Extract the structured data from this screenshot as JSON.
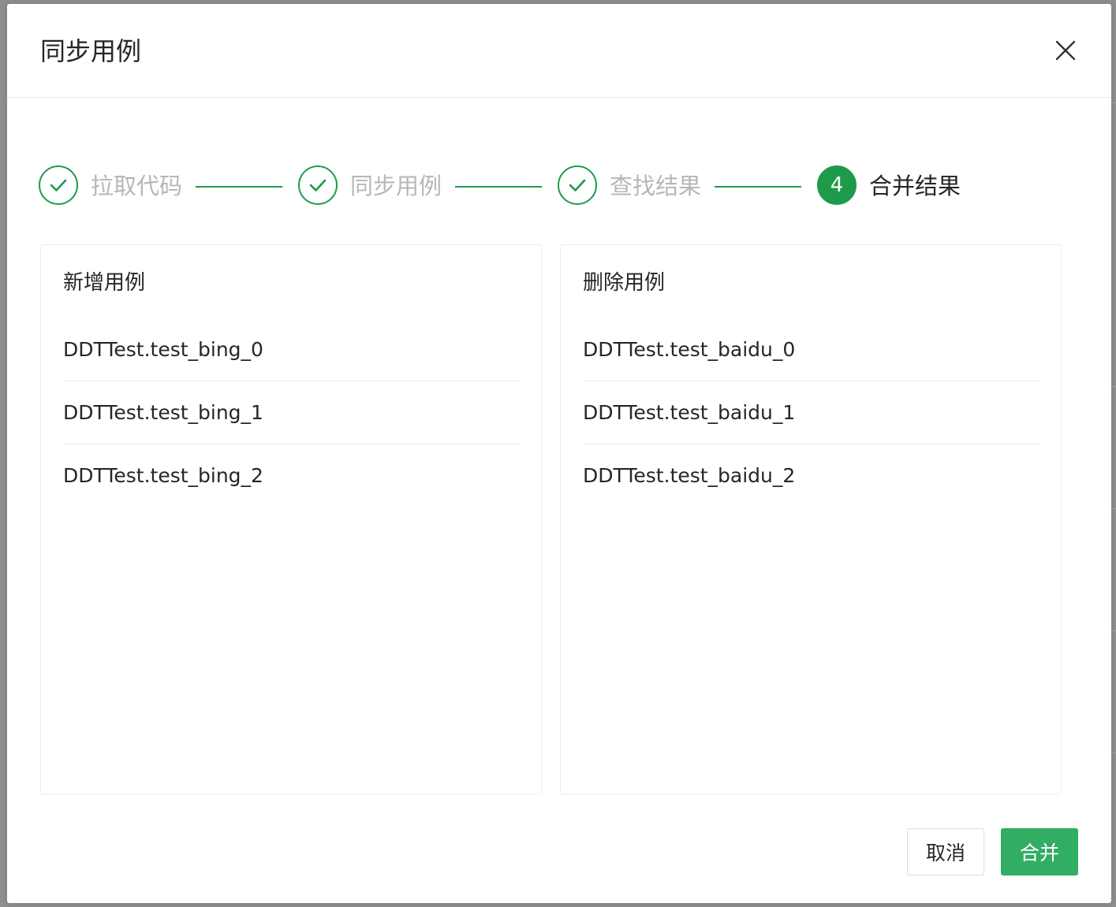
{
  "colors": {
    "accent": "#1e9b4a",
    "primary_button": "#31ad64",
    "text": "#262626",
    "muted_text": "#b7b7b7"
  },
  "dialog": {
    "title": "同步用例",
    "close_icon": "close-icon"
  },
  "steps": [
    {
      "label": "拉取代码",
      "status": "finished",
      "icon": "check-icon"
    },
    {
      "label": "同步用例",
      "status": "finished",
      "icon": "check-icon"
    },
    {
      "label": "查找结果",
      "status": "finished",
      "icon": "check-icon"
    },
    {
      "label": "合并结果",
      "status": "active",
      "number": "4"
    }
  ],
  "added_panel": {
    "title": "新增用例",
    "items": [
      "DDTTest.test_bing_0",
      "DDTTest.test_bing_1",
      "DDTTest.test_bing_2"
    ]
  },
  "removed_panel": {
    "title": "删除用例",
    "items": [
      "DDTTest.test_baidu_0",
      "DDTTest.test_baidu_1",
      "DDTTest.test_baidu_2"
    ]
  },
  "footer": {
    "cancel_label": "取消",
    "merge_label": "合并"
  }
}
